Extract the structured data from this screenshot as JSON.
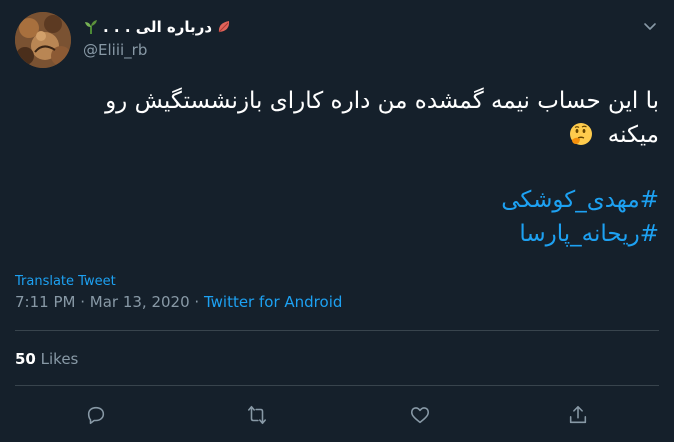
{
  "author": {
    "display_name": "درباره الی . . .",
    "handle": "@Eliii_rb",
    "icons": [
      "sprout-emoji",
      "leaf-emoji"
    ]
  },
  "tweet": {
    "text_line1": "با این حساب نیمه گمشده من داره کارای بازنشستگیش رو",
    "text_line2": "میکنه",
    "emoji": "thinking-face",
    "hashtags": [
      "#مهدی_کوشکی",
      "#ریحانه_پارسا"
    ]
  },
  "translate_label": "Translate Tweet",
  "meta": {
    "time": "7:11 PM",
    "separator1": " · ",
    "date": "Mar 13, 2020",
    "separator2": " · ",
    "source": "Twitter for Android"
  },
  "stats": {
    "likes_count": "50",
    "likes_label": " Likes"
  },
  "actions": [
    "reply-icon",
    "retweet-icon",
    "like-icon",
    "share-icon"
  ],
  "colors": {
    "background": "#15202b",
    "accent": "#1da1f2",
    "muted": "#8899a6",
    "divider": "#38444d"
  }
}
